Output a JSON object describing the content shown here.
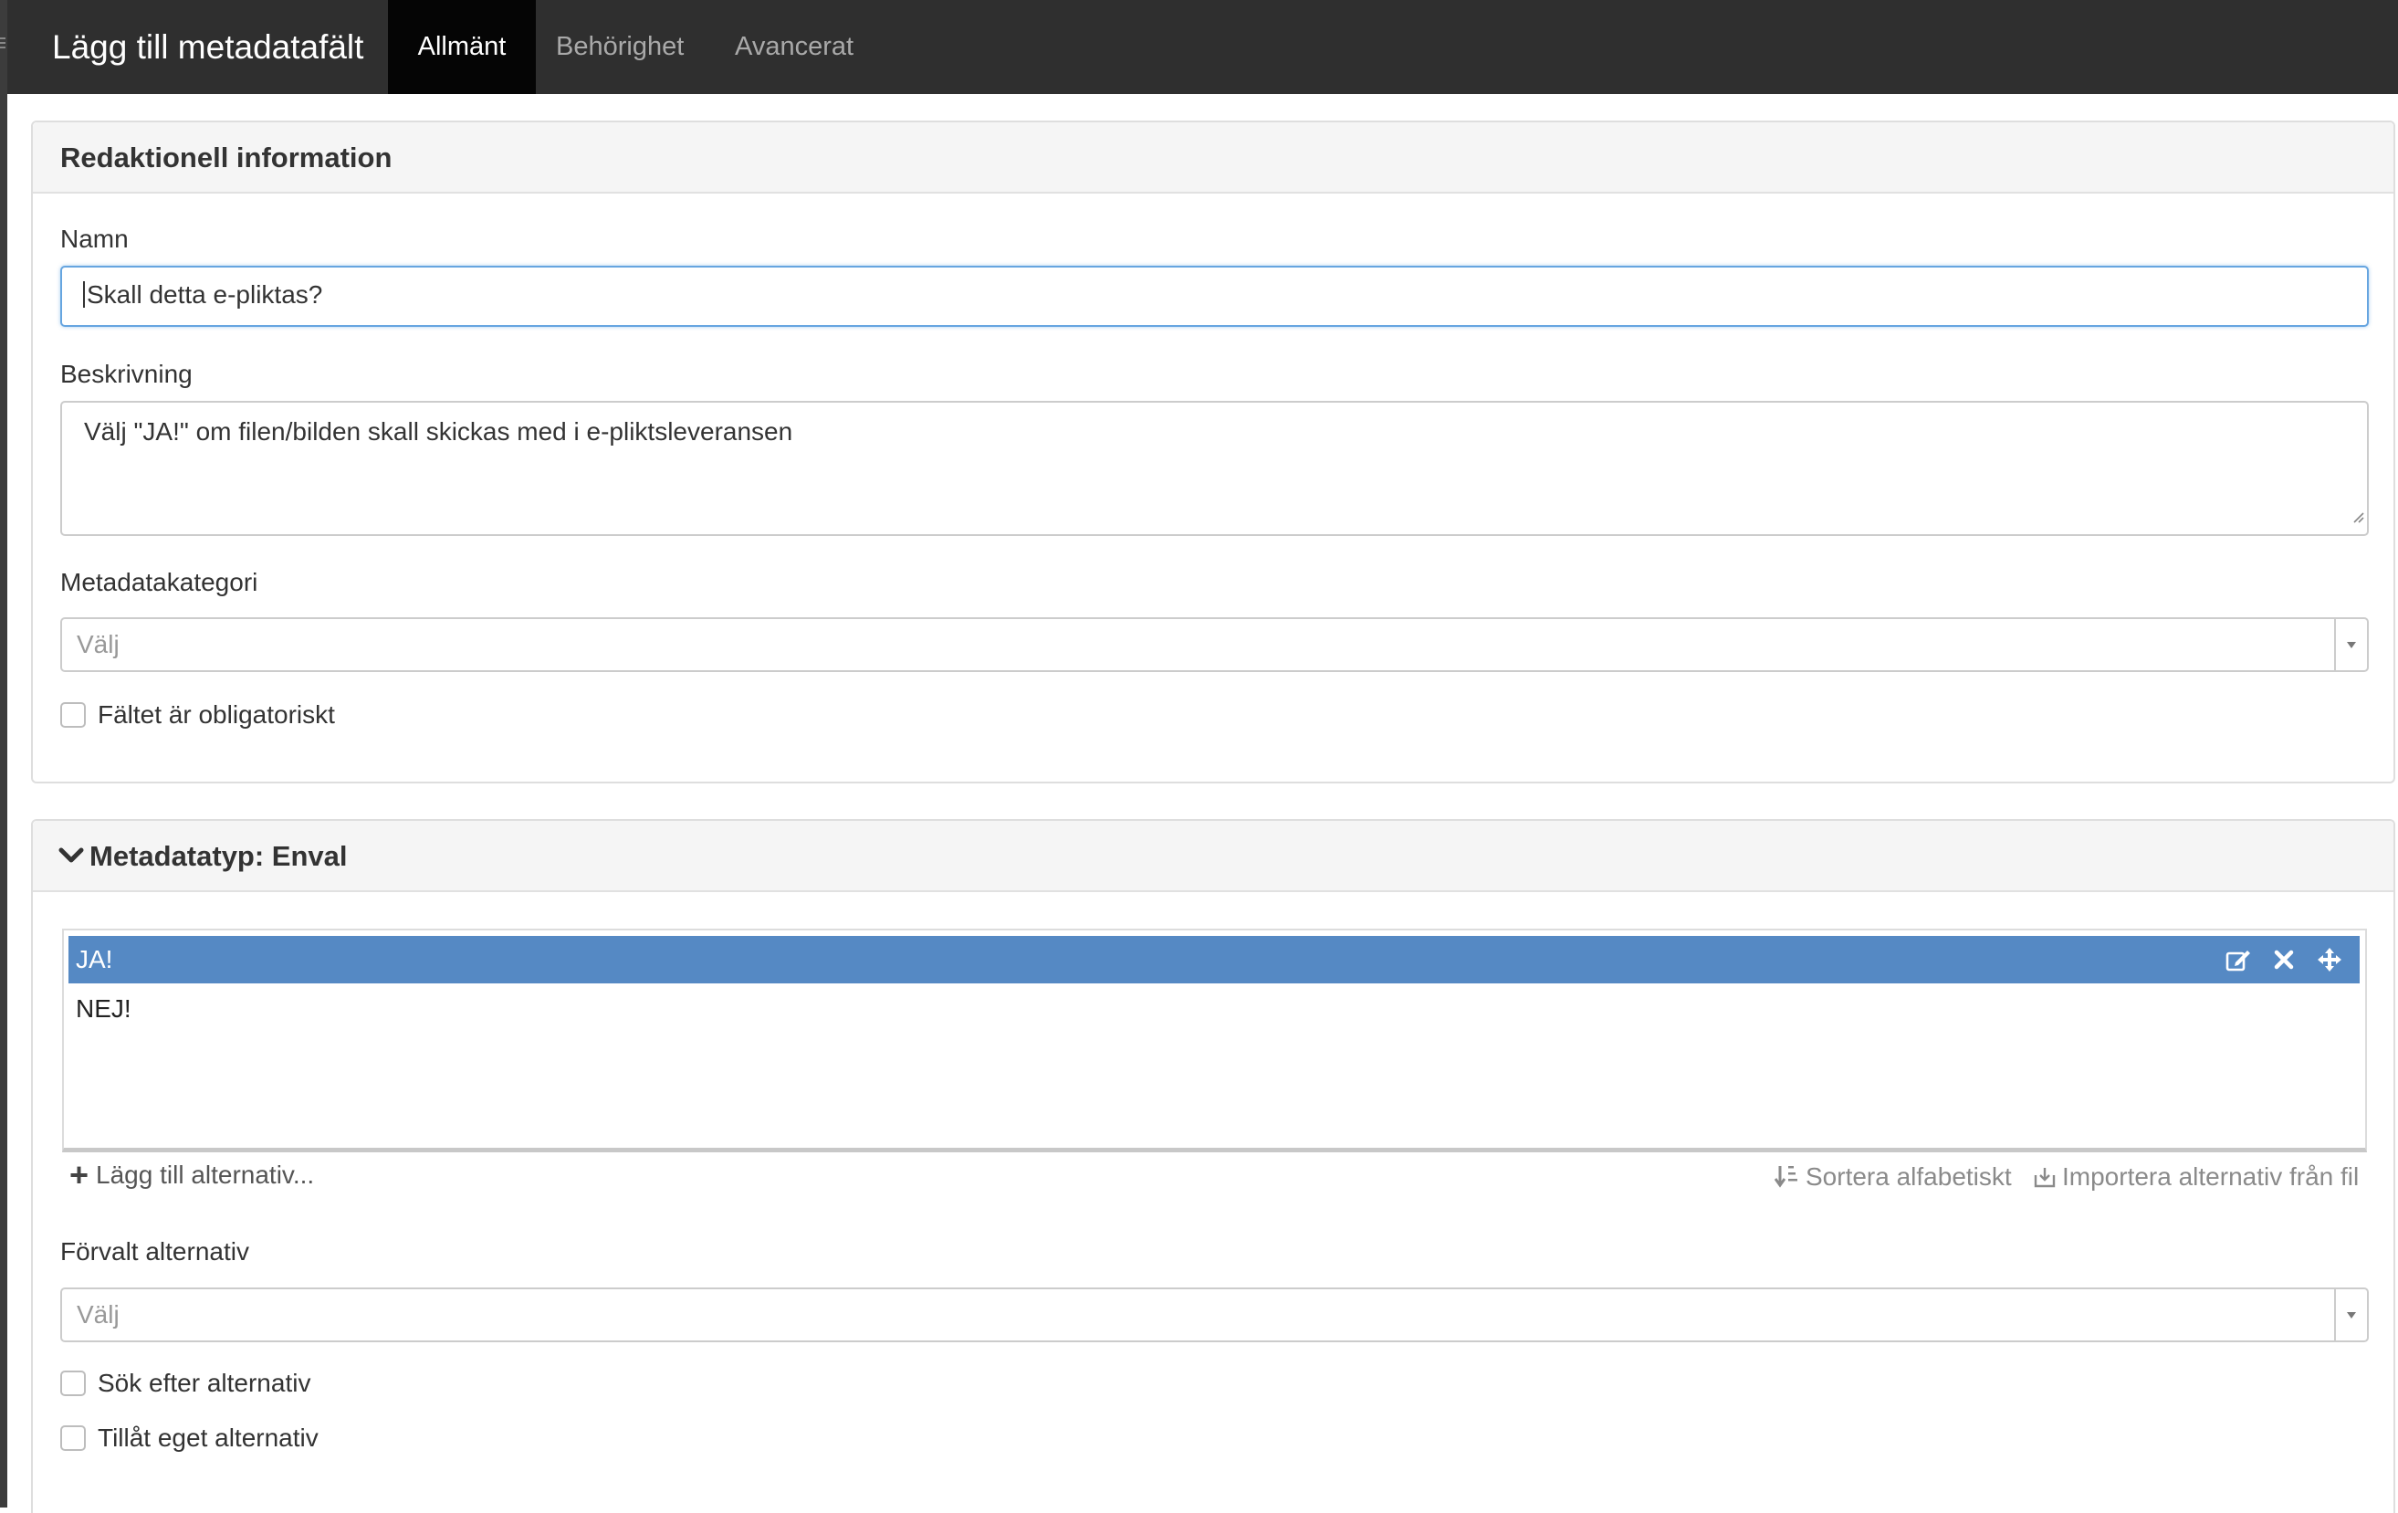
{
  "header": {
    "title": "Lägg till metadatafält",
    "tabs": [
      {
        "label": "Allmänt",
        "active": true
      },
      {
        "label": "Behörighet",
        "active": false
      },
      {
        "label": "Avancerat",
        "active": false
      }
    ]
  },
  "editorial": {
    "title": "Redaktionell information",
    "name_label": "Namn",
    "name_value": "Skall detta e-pliktas?",
    "description_label": "Beskrivning",
    "description_value": "Välj \"JA!\" om filen/bilden skall skickas med i e-pliktsleveransen",
    "category_label": "Metadatakategori",
    "category_value": "Välj",
    "required_label": "Fältet är obligatoriskt",
    "required_checked": false
  },
  "metadata_type": {
    "title": "Metadatatyp: Enval",
    "options": [
      {
        "label": "JA!",
        "selected": true
      },
      {
        "label": "NEJ!",
        "selected": false
      }
    ],
    "add_option_label": "Lägg till alternativ...",
    "sort_label": "Sortera alfabetiskt",
    "import_label": "Importera alternativ från fil",
    "default_label": "Förvalt alternativ",
    "default_value": "Välj",
    "search_label": "Sök efter alternativ",
    "search_checked": false,
    "custom_label": "Tillåt eget alternativ",
    "custom_checked": false
  },
  "colors": {
    "topbar": "#2f2f2f",
    "active_tab": "#050505",
    "selected_option": "#5589c4",
    "focus_border": "#66a5e0"
  },
  "icons": [
    "chevron-down-icon",
    "edit-icon",
    "close-icon",
    "move-icon",
    "plus-icon",
    "sort-icon",
    "import-icon",
    "dropdown-arrow-icon"
  ]
}
